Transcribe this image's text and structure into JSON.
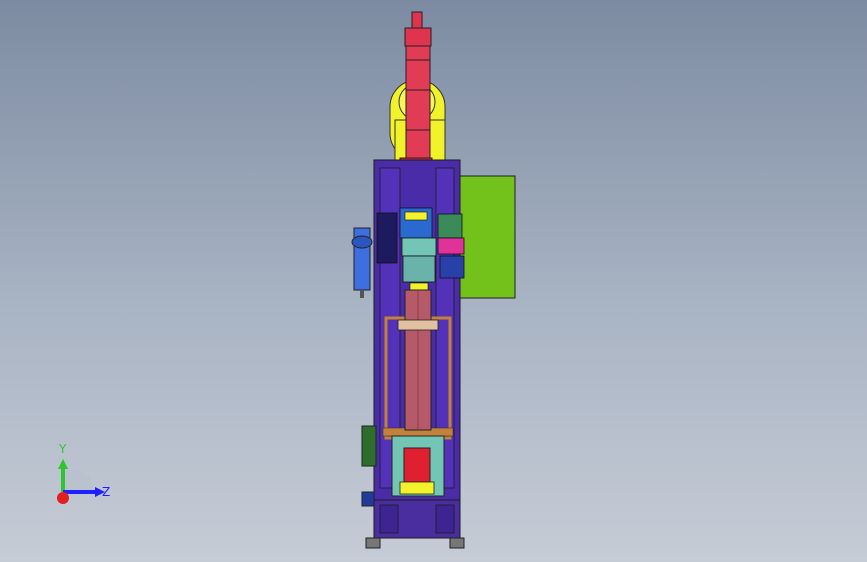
{
  "viewport": {
    "background_top": "#7d8ba2",
    "background_bottom": "#c6ccd6"
  },
  "model": {
    "description_icon": "cad-press-machine-model",
    "colors": {
      "frame": "#4b2ca8",
      "cylinder": "#e0344e",
      "cylinder_rod": "#b65a6a",
      "yellow_part": "#f2f22a",
      "green_panel": "#72c21b",
      "teal_part": "#73c6b6",
      "tan_frame": "#c4813a",
      "magenta_part": "#e0339a"
    }
  },
  "triad": {
    "y_label": "Y",
    "z_label": "Z",
    "y_color": "#31c431",
    "z_color": "#2020ff",
    "x_color": "#e02020"
  }
}
